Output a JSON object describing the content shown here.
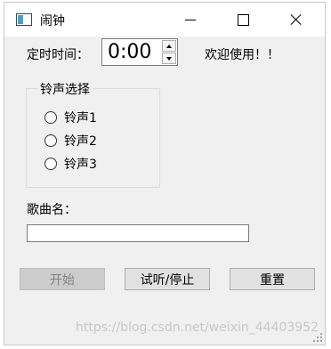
{
  "window": {
    "title": "闹钟",
    "controls": {
      "minimize": "minimize-icon",
      "maximize": "maximize-icon",
      "close": "close-icon"
    }
  },
  "timer": {
    "label": "定时时间：",
    "value": "0:00"
  },
  "welcome": "欢迎使用！！",
  "ringtone": {
    "group_title": "铃声选择",
    "options": [
      "铃声1",
      "铃声2",
      "铃声3"
    ]
  },
  "song": {
    "label": "歌曲名：",
    "value": ""
  },
  "buttons": {
    "start": "开始",
    "preview_stop": "试听/停止",
    "reset": "重置"
  },
  "watermark": "https://blog.csdn.net/weixin_44403952",
  "colors": {
    "window_bg": "#f0f0f0",
    "button_bg": "#e1e1e1",
    "disabled_bg": "#cccccc",
    "disabled_text": "#838383"
  }
}
